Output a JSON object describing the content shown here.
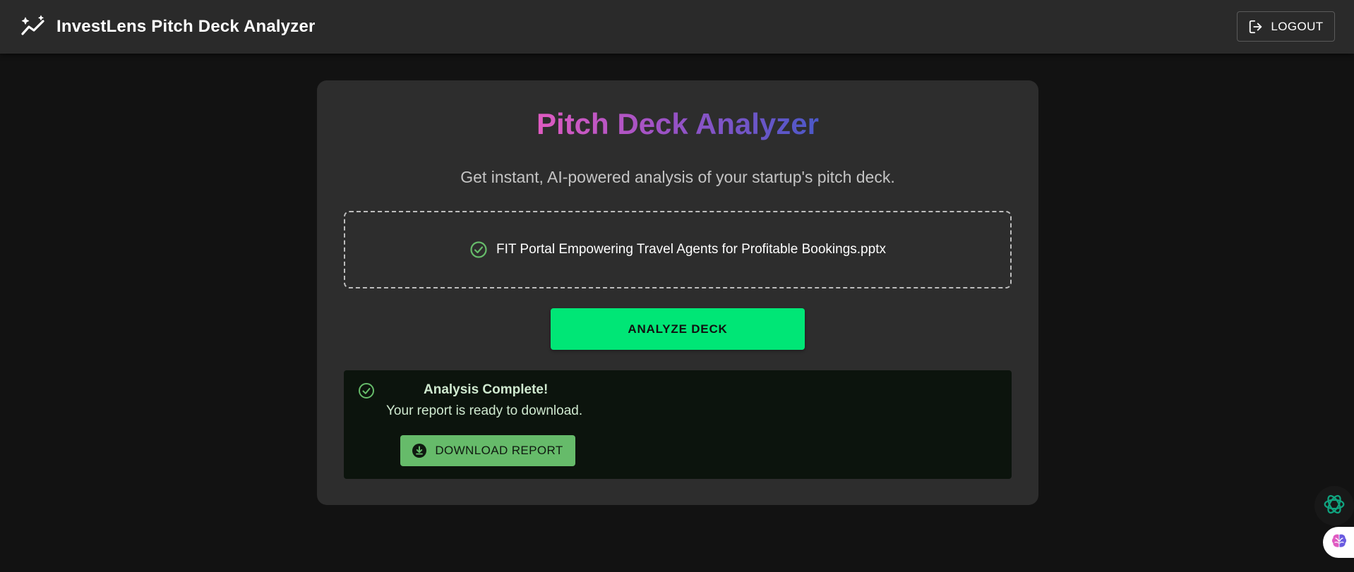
{
  "app": {
    "title": "InvestLens Pitch Deck Analyzer",
    "logout_label": "LOGOUT"
  },
  "card": {
    "title": "Pitch Deck Analyzer",
    "subtitle": "Get instant, AI-powered analysis of your startup's pitch deck.",
    "uploaded_file": "FIT Portal Empowering Travel Agents for Profitable Bookings.pptx",
    "analyze_label": "ANALYZE DECK"
  },
  "alert": {
    "title": "Analysis Complete!",
    "message": "Your report is ready to download.",
    "download_label": "DOWNLOAD REPORT"
  },
  "colors": {
    "appbar_bg": "#2a2a2a",
    "page_bg": "#121212",
    "card_bg": "#2d2d2d",
    "accent_green": "#00e676",
    "success_green": "#66bb6a",
    "title_gradient": [
      "#e05bc2",
      "#9c52c5",
      "#4b58c8"
    ]
  },
  "icons": {
    "brand": "sparkle-trend-icon",
    "logout": "logout-icon",
    "file_status": "check-circle-icon",
    "alert": "check-circle-icon",
    "download": "download-icon",
    "fab_ai": "openai-icon",
    "fab_brain": "brain-icon"
  }
}
